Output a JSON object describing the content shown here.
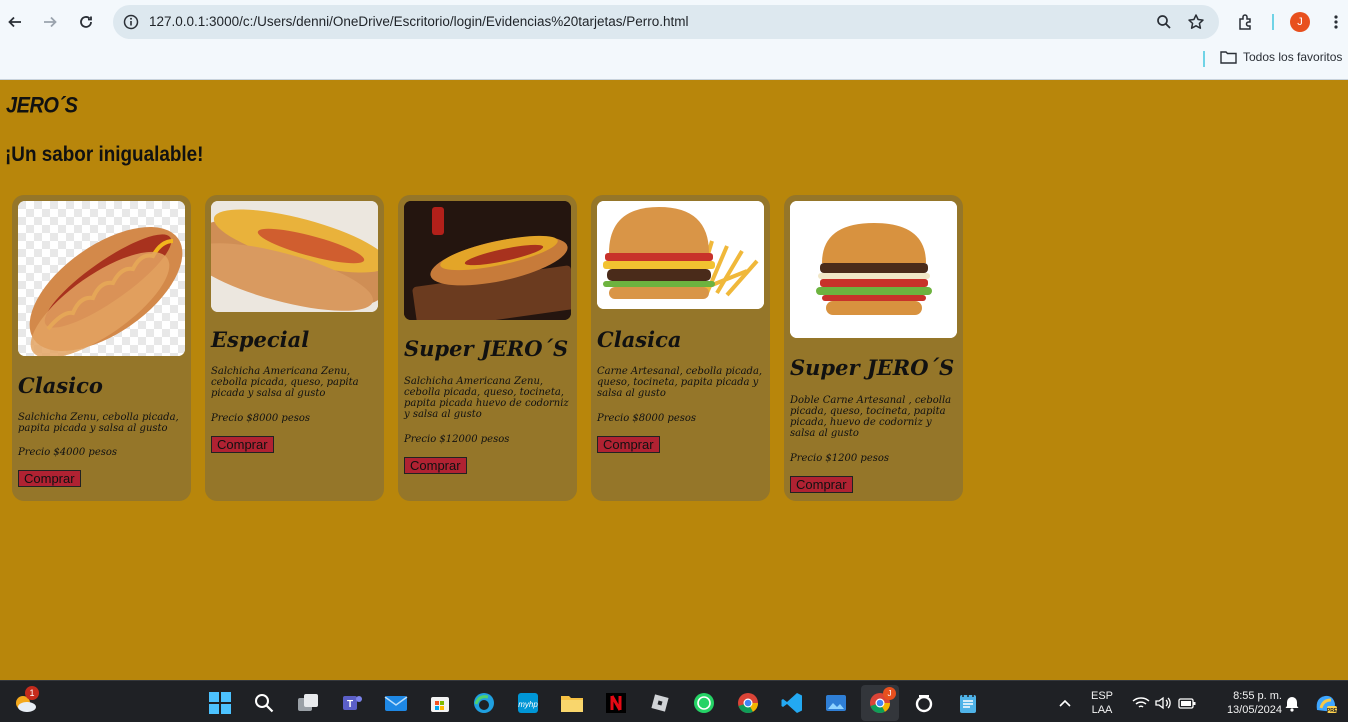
{
  "browser": {
    "url": "127.0.0.1:3000/c:/Users/denni/OneDrive/Escritorio/login/Evidencias%20tarjetas/Perro.html",
    "profile_initial": "J",
    "bookmarks_folder": "Todos los favoritos"
  },
  "page": {
    "brand": "JERO´S",
    "slogan": "¡Un sabor inigualable!",
    "accent_color": "#b8860b",
    "card_color": "#957629",
    "button_color": "#b02232",
    "cards": [
      {
        "name": "Clasico",
        "description": "Salchicha Zenu, cebolla picada, papita picada y salsa al gusto",
        "price": "Precio $4000 pesos",
        "button": "Comprar",
        "image": "hotdog-mustard"
      },
      {
        "name": "Especial",
        "description": "Salchicha Americana Zenu, cebolla picada, queso, papita picada y salsa al gusto",
        "price": "Precio $8000 pesos",
        "button": "Comprar",
        "image": "hotdog-cheese"
      },
      {
        "name": "Super JERO´S",
        "description": "Salchicha Americana Zenu, cebolla picada, queso, tocineta, papita picada huevo de codorniz y salsa al gusto",
        "price": "Precio $12000 pesos",
        "button": "Comprar",
        "image": "hotdog-loaded"
      },
      {
        "name": "Clasica",
        "description": "Carne Artesanal, cebolla picada, queso, tocineta, papita picada y salsa al gusto",
        "price": "Precio $8000 pesos",
        "button": "Comprar",
        "image": "burger-fries"
      },
      {
        "name": "Super JERO´S",
        "description": "Doble Carne Artesanal , cebolla picada, queso, tocineta, papita picada, huevo de codorniz y salsa al gusto",
        "price": "Precio $1200 pesos",
        "button": "Comprar",
        "image": "burger-double"
      }
    ]
  },
  "taskbar": {
    "weather_badge": "1",
    "chrome_badge": "J",
    "language": "ESP",
    "layout": "LAA",
    "time": "8:55 p. m.",
    "date": "13/05/2024"
  }
}
